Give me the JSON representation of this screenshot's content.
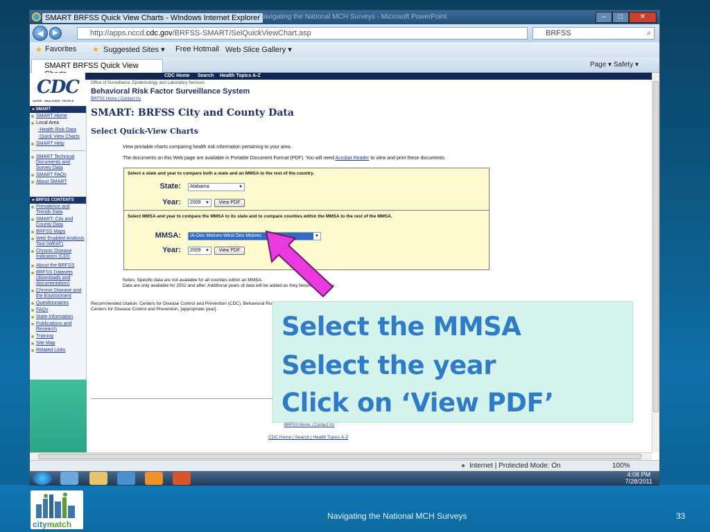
{
  "window": {
    "title": "SMART BRFSS Quick View Charts - Windows Internet Explorer",
    "bg_title": "Navigating the National MCH Surveys - Microsoft PowerPoint",
    "url_prefix": "http://apps.nccd.",
    "url_domain": "cdc.gov",
    "url_path": "/BRFSS-SMART/SelQuickViewChart.asp",
    "search_text": "BRFSS",
    "favorites": "Favorites",
    "suggested_sites": "Suggested Sites ▾",
    "free_hotmail": "Free Hotmail",
    "web_slice": "Web Slice Gallery ▾",
    "tab_title": "SMART BRFSS Quick View Charts",
    "tab_tools": "Page ▾   Safety ▾",
    "status": "Internet | Protected Mode: On",
    "zoom": "100%",
    "clock_time": "4:08 PM",
    "clock_date": "7/28/2011"
  },
  "cdc": {
    "logo": "CDC",
    "logo_tagline": "SAFER · HEALTHIER · PEOPLE",
    "topnav": [
      "CDC Home",
      "Search",
      "Health Topics A-Z"
    ],
    "org_line": "Office of Surveillance, Epidemiology, and Laboratory Services",
    "system_title": "Behavioral Risk Factor Surveillance System",
    "top_links": "BRFSS Home | Contact Us"
  },
  "sidebar": {
    "smart_head": "SMART",
    "smart_home": "SMART Home",
    "local_area": "Local Area",
    "health_risk": "-Health Risk Data",
    "quick_view": "-Quick View Charts",
    "smart_help": "SMART Help",
    "tech_docs_1": "SMART Technical",
    "tech_docs_2": "Documents and",
    "tech_docs_3": "Survey Data",
    "faqs": "SMART FAQs",
    "about": "About SMART",
    "brfss_head": "BRFSS CONTENTS",
    "items": [
      "Prevalence and Trends Data",
      "SMART: City and County Data",
      "BRFSS Maps",
      "Web Enabled Analysis Tool (WEAT)",
      "Chronic Disease Indicators (CDI)",
      "About the BRFSS",
      "BRFSS Datasets (downloads and documentation)",
      "Chronic Disease and the Environment",
      "Questionnaires",
      "FAQs",
      "State Information",
      "Publications and Research",
      "Training",
      "Site Map",
      "Related Links"
    ]
  },
  "main": {
    "h1": "SMART: BRFSS City and County Data",
    "h2": "Select Quick-View Charts",
    "p1": "View printable charts comparing health risk information pertaining to your area.",
    "p2_pre": "The documents on this Web page are available in Portable Document Format (PDF). You will need ",
    "p2_link": "Acrobat Reader",
    "p2_post": " to view and print these documents.",
    "sec1_inst": "Select a state and year to compare both a state and an MMSA to the rest of the country.",
    "state_label": "State:",
    "state_value": "Alabama",
    "year_label": "Year:",
    "year_value": "2009",
    "view_pdf": "View PDF",
    "sec2_inst": "Select MMSA and year to compare the MMSA to its state and to compare counties within the MMSA to the rest of the MMSA.",
    "mmsa_label": "MMSA:",
    "mmsa_value": "IA-Des Moines-West Des Moines",
    "year2_value": "2009",
    "notes_1": "Notes: Specific data are not available for all counties within an MMSA.",
    "notes_2": "Data are only available for 2002 and after. Additional years of data will be added as they become available.",
    "citation": "Recommended citation:  Centers for Disease Control and Prevention (CDC). Behavioral Risk Factor Surveillance System Survey Data. Atlanta, Georgia: U.S. Department of Health and Human Services, Centers for Disease Control and Prevention, [appropriate year].",
    "bottom_links_small": "BRFSS Home | Contact Us",
    "bottom_links": "CDC Home | Search | Health Topics A-Z"
  },
  "callout": {
    "line1": "Select the MMSA",
    "line2": "Select the year",
    "line3": "Click on ‘View PDF’"
  },
  "slide": {
    "footer": "Navigating the National MCH Surveys",
    "page": "33",
    "logo_text_a": "city",
    "logo_text_b": "match"
  },
  "colors": {
    "accent": "#2f7bc5",
    "arrow": "#e83adf",
    "callout_bg": "#d3f3ec",
    "form_bg": "#fffbd0",
    "cdc_navy": "#1d2f66"
  }
}
